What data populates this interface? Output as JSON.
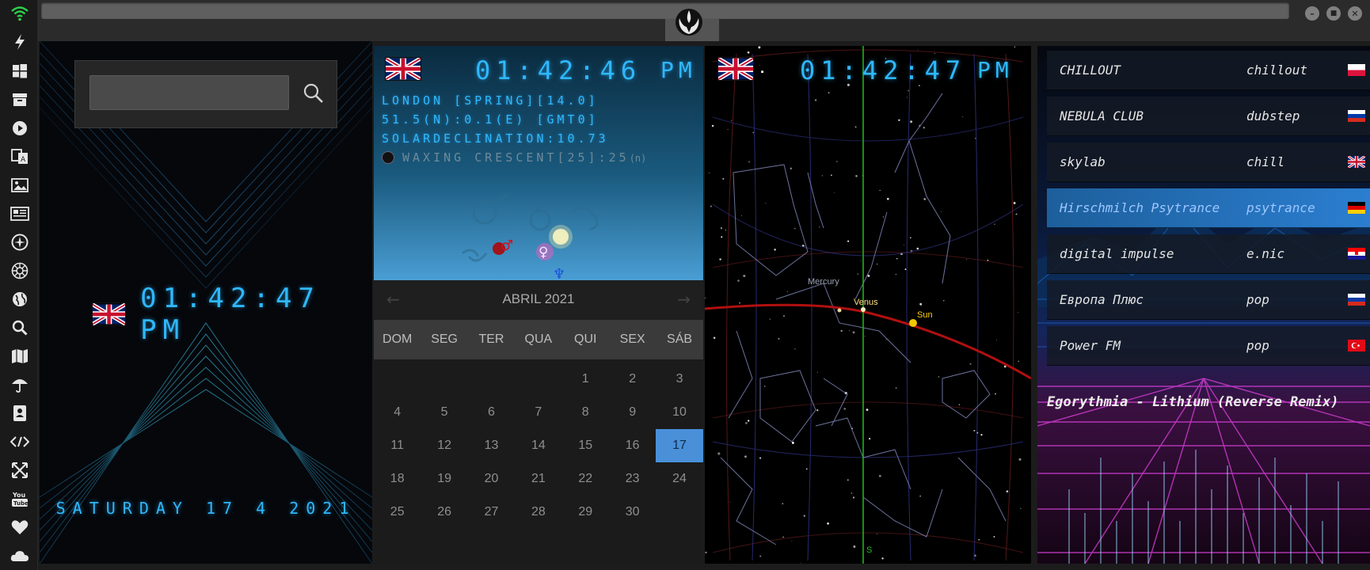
{
  "sidebar": {
    "icons": [
      "wifi-icon",
      "bolt-icon",
      "windows-icon",
      "archive-icon",
      "play-icon",
      "translate-icon",
      "image-icon",
      "news-icon",
      "rebel-icon",
      "empire-icon",
      "globe-icon",
      "search-icon",
      "map-icon",
      "umbrella-icon",
      "contacts-icon",
      "code-icon",
      "expand-icon",
      "youtube-icon",
      "heart-icon",
      "cloud-icon"
    ]
  },
  "window": {
    "minimize": "–",
    "maximize": "■",
    "close": "✕"
  },
  "clock_panel": {
    "search": {
      "value": "",
      "placeholder": ""
    },
    "time": "01:42:47 PM",
    "date": "SATURDAY 17 4 2021"
  },
  "astro_panel": {
    "time": "01:42:46",
    "ampm": "PM",
    "location": "LONDON [SPRING][14.0]",
    "coords": "51.5(N):0.1(E) [GMT0]",
    "solar": "SOLARDECLINATION:10.73",
    "moon": "WAXING CRESCENT[25]:25",
    "moon_suffix": "(n)",
    "planet_symbols": {
      "mars": "♂",
      "venus": "♀",
      "neptune": "♆"
    }
  },
  "calendar": {
    "prev": "←",
    "next": "→",
    "month": "ABRIL 2021",
    "weekdays": [
      "DOM",
      "SEG",
      "TER",
      "QUA",
      "QUI",
      "SEX",
      "SÁB"
    ],
    "weeks": [
      [
        "",
        "",
        "",
        "",
        "1",
        "2",
        "3"
      ],
      [
        "4",
        "5",
        "6",
        "7",
        "8",
        "9",
        "10"
      ],
      [
        "11",
        "12",
        "13",
        "14",
        "15",
        "16",
        "17"
      ],
      [
        "18",
        "19",
        "20",
        "21",
        "22",
        "23",
        "24"
      ],
      [
        "25",
        "26",
        "27",
        "28",
        "29",
        "30",
        ""
      ]
    ],
    "today": "17"
  },
  "sky_panel": {
    "time": "01:42:47",
    "ampm": "PM",
    "labels": {
      "mercury": "Mercury",
      "venus": "Venus",
      "sun": "Sun",
      "south": "S"
    }
  },
  "radio": {
    "stations": [
      {
        "name": "CHILLOUT",
        "genre": "chillout",
        "flag": "pl"
      },
      {
        "name": "NEBULA CLUB",
        "genre": "dubstep",
        "flag": "ru"
      },
      {
        "name": "skylab",
        "genre": "chill",
        "flag": "gb"
      },
      {
        "name": "Hirschmilch Psytrance",
        "genre": "psytrance",
        "flag": "de"
      },
      {
        "name": "digital impulse",
        "genre": "e.nic",
        "flag": "hr"
      },
      {
        "name": "Европа Плюс",
        "genre": "pop",
        "flag": "ru"
      },
      {
        "name": "Power FM",
        "genre": "pop",
        "flag": "tr"
      }
    ],
    "active_index": 3,
    "now_playing": "Egorythmia - Lithium (Reverse Remix)"
  },
  "colors": {
    "digital": "#2fb8ff",
    "calendar_today": "#4a90d9",
    "ecliptic": "#b01010",
    "meridian": "#19c219"
  }
}
